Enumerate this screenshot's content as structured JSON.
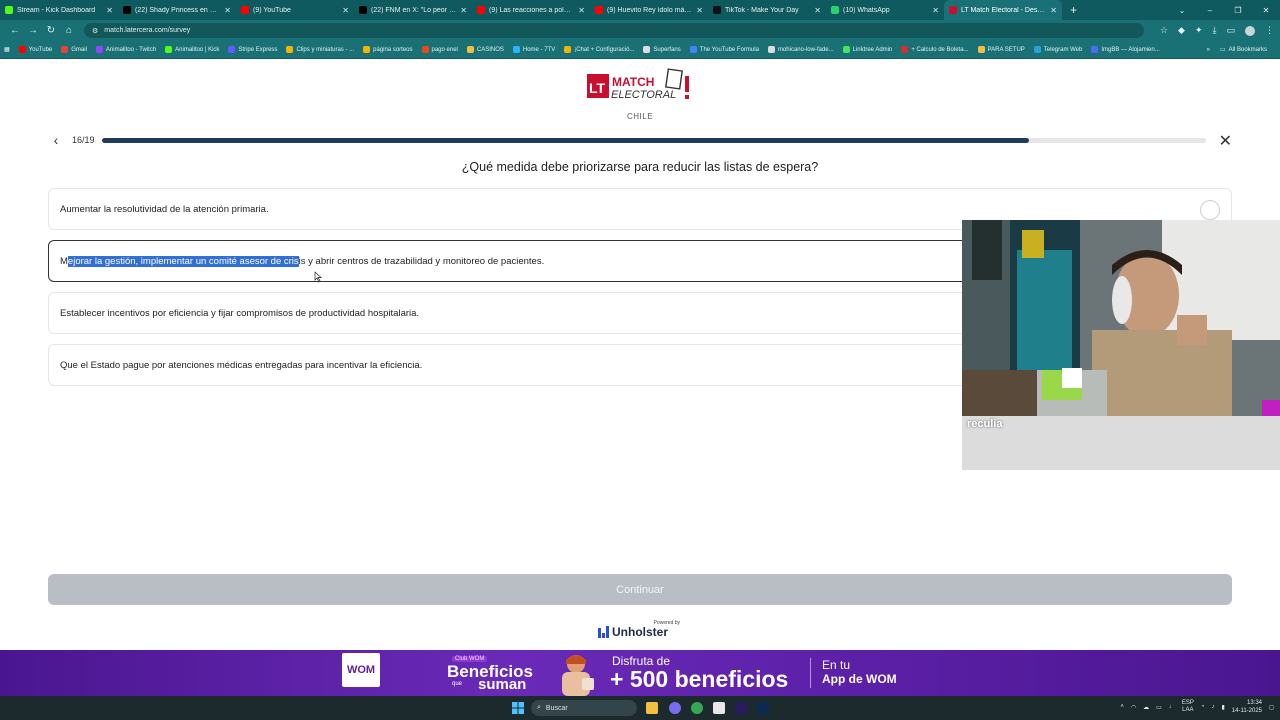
{
  "browser": {
    "tabs": [
      {
        "title": "Stream - Kick Dashboard",
        "fav": "#53fc18"
      },
      {
        "title": "(22) Shady Princess en X: \"9 mil",
        "fav": "#000000"
      },
      {
        "title": "(9) YouTube",
        "fav": "#ff0000"
      },
      {
        "title": "(22) FNM en X: \"Lo peor del vid",
        "fav": "#000000"
      },
      {
        "title": "(9) Las reacciones a polémico vi",
        "fav": "#ff0000"
      },
      {
        "title": "(9) Huevito Rey ídolo máximo",
        "fav": "#ff0000"
      },
      {
        "title": "TikTok - Make Your Day",
        "fav": "#111111"
      },
      {
        "title": "(10) WhatsApp",
        "fav": "#25d366"
      },
      {
        "title": "LT Match Electoral - Descubre c",
        "fav": "#c8102e"
      }
    ],
    "active_tab_index": 8,
    "url": "match.latercera.com/survey",
    "bookmarks": [
      {
        "label": "YouTube",
        "color": "#ff0000"
      },
      {
        "label": "Gmail",
        "color": "#ea4335"
      },
      {
        "label": "Animalitoo - Twitch",
        "color": "#9146ff"
      },
      {
        "label": "Animalitoo | Kick",
        "color": "#53fc18"
      },
      {
        "label": "Stripe Express",
        "color": "#635bff"
      },
      {
        "label": "Clips y miniaturas - ...",
        "color": "#f4b400"
      },
      {
        "label": "página sorteos",
        "color": "#f4b400"
      },
      {
        "label": "pago enel",
        "color": "#e64a19"
      },
      {
        "label": "CASINOS",
        "color": "#f0c040"
      },
      {
        "label": "Home - 7TV",
        "color": "#29b6f6"
      },
      {
        "label": "¡Chat + Configuració...",
        "color": "#f4b400"
      },
      {
        "label": "Superfans",
        "color": "#dddddd"
      },
      {
        "label": "The YouTube Formula",
        "color": "#4285f4"
      },
      {
        "label": "mohicano-low-fade...",
        "color": "#dddddd"
      },
      {
        "label": "Linktree Admin",
        "color": "#43e660"
      },
      {
        "label": "+ Calculo de Boleta...",
        "color": "#d32f2f"
      },
      {
        "label": "PARA SETUP",
        "color": "#f0c040"
      },
      {
        "label": "Telegram Web",
        "color": "#2aa1da"
      },
      {
        "label": "ImgBB — Alojamien...",
        "color": "#4a6cf7"
      }
    ],
    "all_bookmarks_label": "All Bookmarks"
  },
  "survey": {
    "logo": {
      "lt": "LT",
      "match": "MATCH",
      "electoral": "ELECTORAL"
    },
    "country": "CHILE",
    "step_label": "16/19",
    "progress": 0.84,
    "question": "¿Qué medida debe priorizarse para reducir las listas de espera?",
    "options": [
      {
        "text": "Aumentar la resolutividad de la atención primaria."
      },
      {
        "text_before": "M",
        "text_highlight": "ejorar la gestión, implementar un comité asesor de cris",
        "text_after": "is y abrir centros de trazabilidad y monitoreo de pacientes."
      },
      {
        "text": "Establecer incentivos por eficiencia y fijar compromisos de productividad hospitalaria."
      },
      {
        "text": "Que el Estado pague por atenciones médicas entregadas para incentivar la eficiencia."
      }
    ],
    "selected_option_index": 1,
    "continue_label": "Continuar",
    "powered_by": "Powered by",
    "powered_brand": "Unholster"
  },
  "webcam": {
    "username": "reculia"
  },
  "ad": {
    "brand": "WOM",
    "club": "Club WOM",
    "beneficios": "Beneficios",
    "que": "que",
    "suman": "suman",
    "disfruta": "Disfruta de",
    "headline": "+ 500 beneficios",
    "en_tu": "En tu",
    "app": "App de WOM"
  },
  "taskbar": {
    "search_placeholder": "Buscar",
    "lang_top": "ESP",
    "lang_bottom": "LAA",
    "time": "13:34",
    "date": "14-11-2025"
  }
}
